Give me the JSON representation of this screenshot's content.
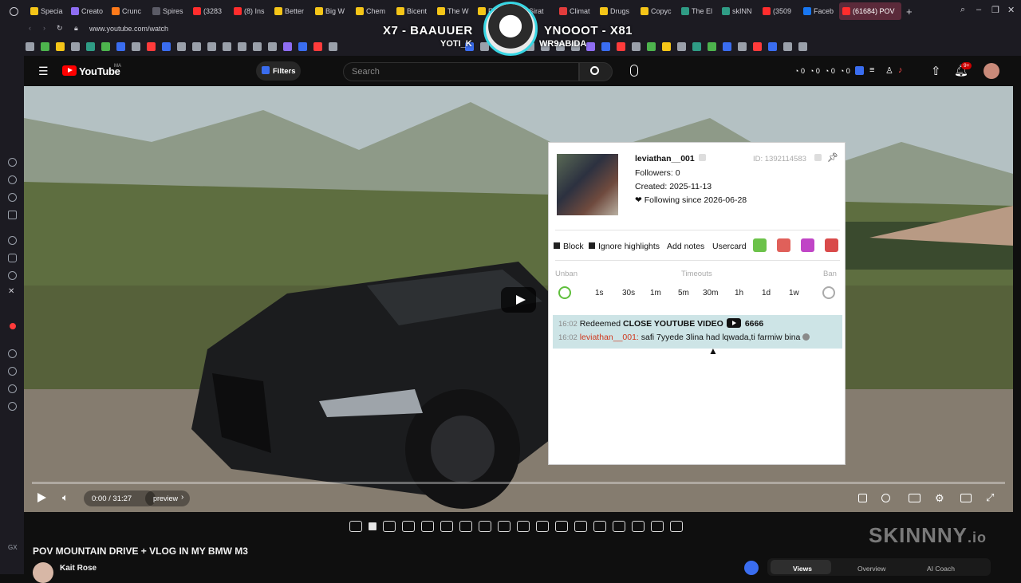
{
  "browser": {
    "tabs": [
      "Specia",
      "Creato",
      "Crunc",
      "Spires",
      "(3283",
      "(8) Ins",
      "Better",
      "Big W",
      "Chem",
      "Bicent",
      "The W",
      "Frequ",
      "Sirat",
      "Climat",
      "Drugs",
      "Copyc",
      "The El",
      "skINN",
      "(3509",
      "Faceb"
    ],
    "active_tab": "(61684) POV",
    "url": "www.youtube.com/watch",
    "accent": "#37d6e3"
  },
  "stream_overlay": {
    "left_title": "X7 - BAAUUER",
    "left_sub": "YOTI_K",
    "right_title": "YNOOOT - X81",
    "right_sub": "WR9ABIDA"
  },
  "youtube": {
    "logo": "YouTube",
    "region": "MA",
    "filters_label": "Filters",
    "search_placeholder": "Search",
    "counters": [
      "0",
      "0",
      "0",
      "0"
    ],
    "notifications_badge": "9+",
    "time_display": "0:00 / 31:27",
    "chapter_label": "preview",
    "video_title": "POV MOUNTAIN DRIVE + VLOG IN MY BMW M3",
    "channel_name": "Kait Rose",
    "bottom_tabs": [
      "Views",
      "Overview",
      "AI Coach"
    ]
  },
  "usercard": {
    "username": "leviathan__001",
    "id_label": "ID: 1392114583",
    "followers": "Followers: 0",
    "created": "Created: 2025-11-13",
    "following_since": "Following since 2026-06-28",
    "heart": "❤",
    "actions": {
      "block": "Block",
      "ignore": "Ignore highlights",
      "notes": "Add notes",
      "usercard": "Usercard"
    },
    "timeout_labels": {
      "unban": "Unban",
      "timeouts": "Timeouts",
      "ban": "Ban"
    },
    "timeouts": [
      "1s",
      "30s",
      "1m",
      "5m",
      "30m",
      "1h",
      "1d",
      "1w"
    ],
    "messages": [
      {
        "time": "16:02",
        "prefix": "Redeemed",
        "title": "CLOSE YOUTUBE VIDEO",
        "cost": "6666"
      },
      {
        "time": "16:02",
        "user": "leviathan__001:",
        "text": " safi 7yyede 3lina had lqwada,ti farmiw bina"
      }
    ]
  },
  "watermark": {
    "brand": "SKINNNY",
    "tld": ".io"
  }
}
